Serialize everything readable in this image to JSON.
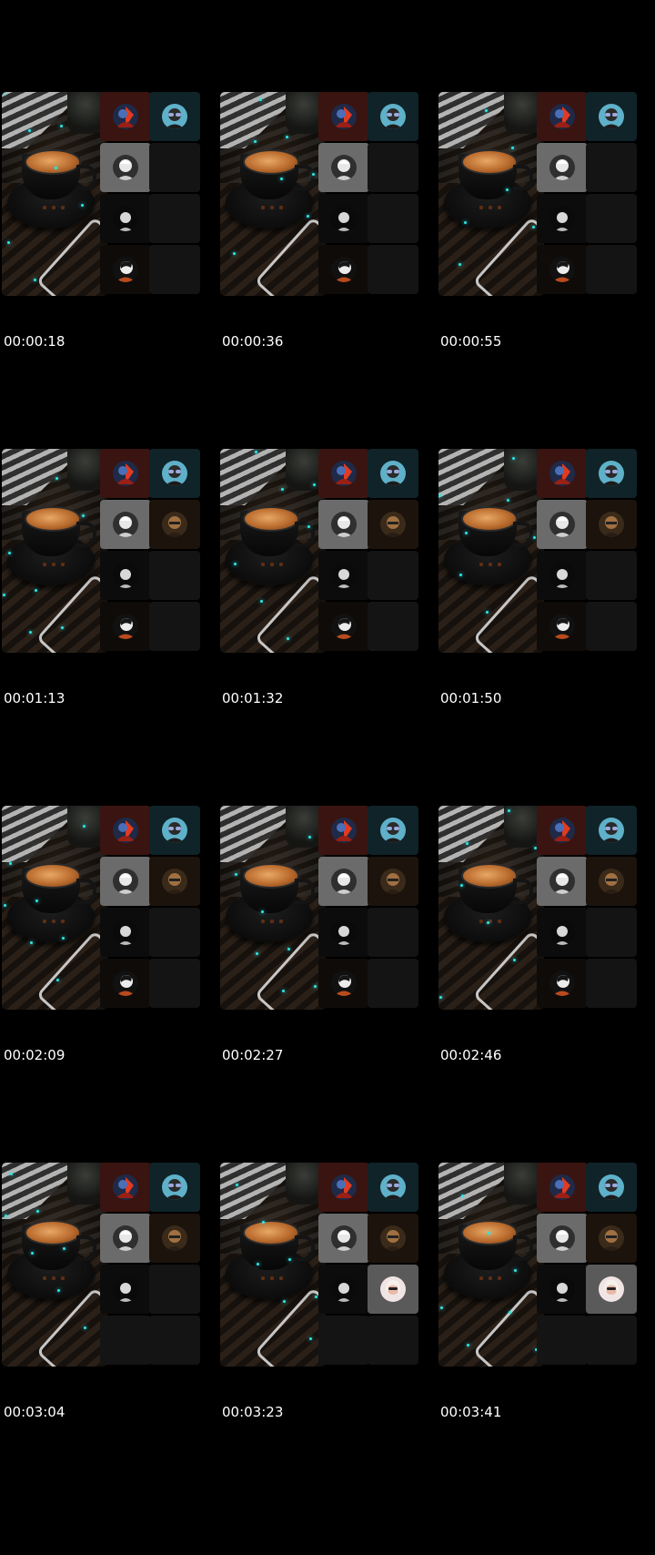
{
  "frames": [
    {
      "timestamp": "00:00:18",
      "extra_avatar": false,
      "bottom_right_avatar": false,
      "hide_row4_avatar": false
    },
    {
      "timestamp": "00:00:36",
      "extra_avatar": false,
      "bottom_right_avatar": false,
      "hide_row4_avatar": false
    },
    {
      "timestamp": "00:00:55",
      "extra_avatar": false,
      "bottom_right_avatar": false,
      "hide_row4_avatar": false
    },
    {
      "timestamp": "00:01:13",
      "extra_avatar": true,
      "bottom_right_avatar": false,
      "hide_row4_avatar": false
    },
    {
      "timestamp": "00:01:32",
      "extra_avatar": true,
      "bottom_right_avatar": false,
      "hide_row4_avatar": false
    },
    {
      "timestamp": "00:01:50",
      "extra_avatar": true,
      "bottom_right_avatar": false,
      "hide_row4_avatar": false
    },
    {
      "timestamp": "00:02:09",
      "extra_avatar": true,
      "bottom_right_avatar": false,
      "hide_row4_avatar": false
    },
    {
      "timestamp": "00:02:27",
      "extra_avatar": true,
      "bottom_right_avatar": false,
      "hide_row4_avatar": false
    },
    {
      "timestamp": "00:02:46",
      "extra_avatar": true,
      "bottom_right_avatar": false,
      "hide_row4_avatar": false
    },
    {
      "timestamp": "00:03:04",
      "extra_avatar": true,
      "bottom_right_avatar": false,
      "hide_row4_avatar": true
    },
    {
      "timestamp": "00:03:23",
      "extra_avatar": true,
      "bottom_right_avatar": true,
      "hide_row4_avatar": true
    },
    {
      "timestamp": "00:03:41",
      "extra_avatar": true,
      "bottom_right_avatar": true,
      "hide_row4_avatar": true
    }
  ],
  "colors": {
    "background": "#000000",
    "text": "#ffffff",
    "accent_particle": "#2ee6e6"
  },
  "icons": [
    "red-blue-hero-avatar-icon",
    "glasses-man-avatar-icon",
    "white-haired-man-avatar-icon",
    "bald-man-avatar-icon",
    "small-portrait-avatar-icon",
    "dark-haired-man-avatar-icon",
    "blonde-woman-avatar-icon"
  ]
}
